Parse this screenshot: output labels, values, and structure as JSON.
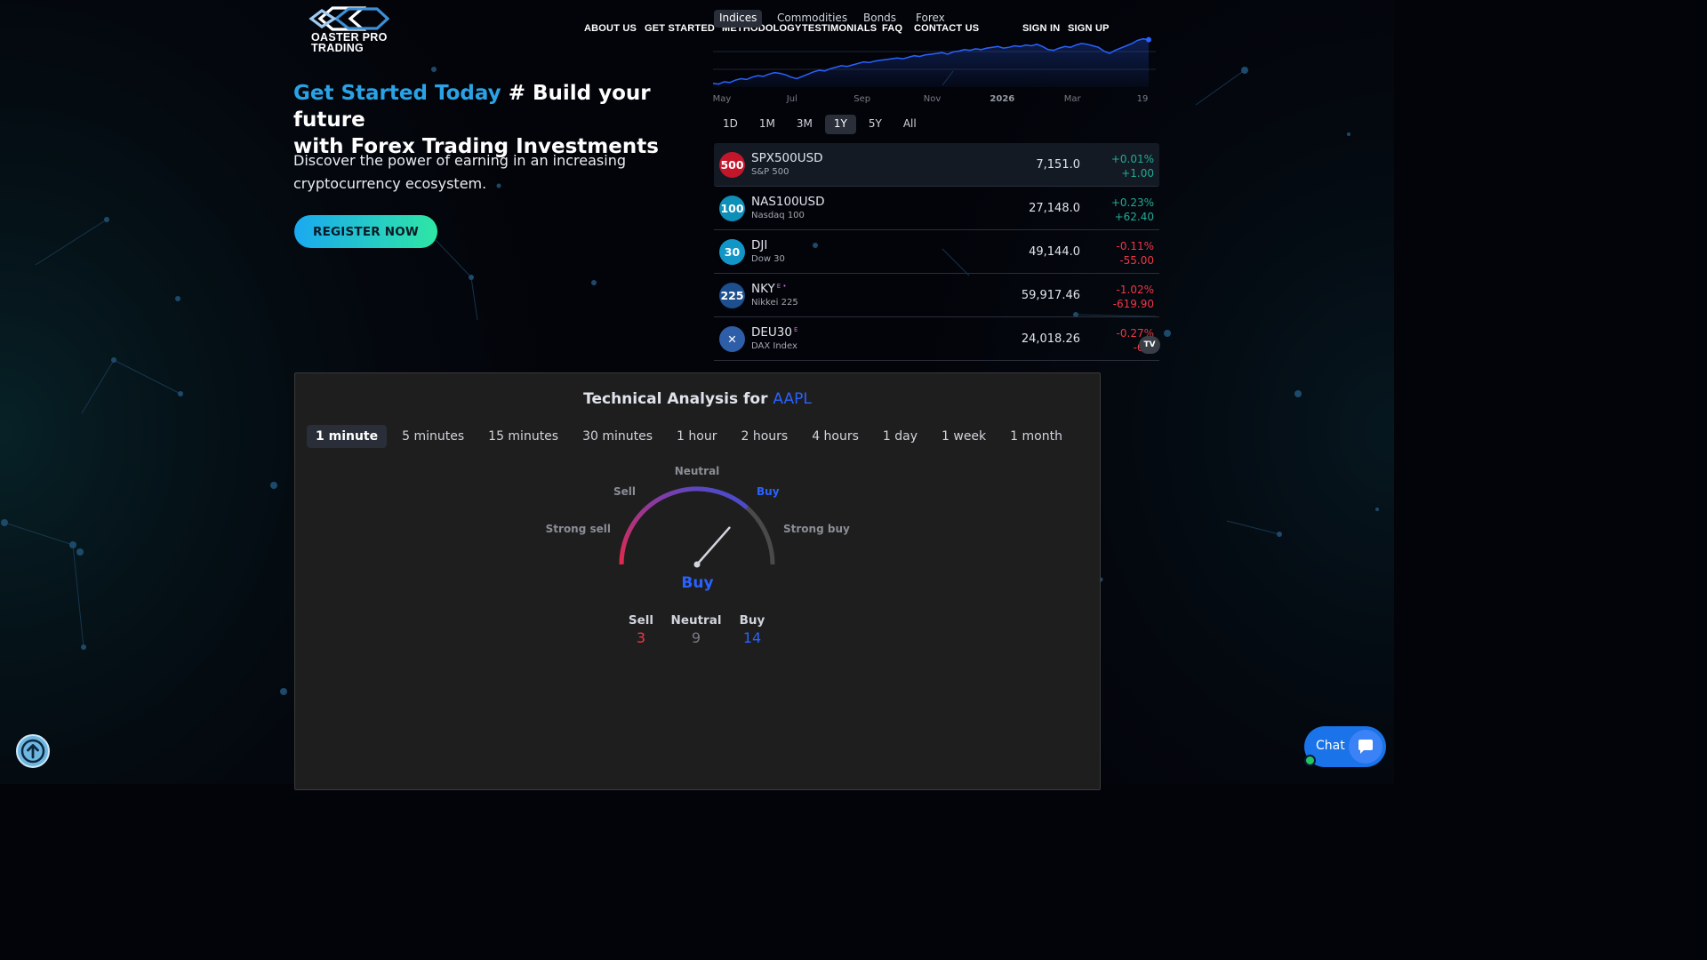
{
  "brand": {
    "line1": "OASTER PRO",
    "line2": "TRADING"
  },
  "nav": {
    "about": "ABOUT US",
    "get_started": "GET STARTED",
    "methodology": "METHODOLOGY",
    "testimonials": "TESTIMONIALS",
    "faq": "FAQ",
    "contact": "CONTACT US",
    "sign_in": "SIGN IN",
    "sign_up": "SIGN UP"
  },
  "market_tabs": [
    "Indices",
    "Commodities",
    "Bonds",
    "Forex"
  ],
  "market_tab_active": "Indices",
  "hero": {
    "title_accent": "Get Started Today",
    "title_rest_1": " # Build your future",
    "title_rest_2": "with Forex Trading Investments",
    "subtitle_1": "Discover the power of earning in an increasing",
    "subtitle_2": "cryptocurrency ecosystem.",
    "cta": "REGISTER NOW"
  },
  "chart_data": {
    "type": "area",
    "series": [
      {
        "values": [
          100,
          99,
          102,
          101,
          104,
          106,
          105,
          108,
          110,
          109,
          112,
          114,
          113,
          111,
          108,
          106,
          109,
          112,
          115,
          117,
          116,
          119,
          121,
          123,
          122,
          124,
          126,
          128,
          127,
          129,
          130,
          131,
          132,
          133,
          132,
          134,
          136,
          135,
          137,
          138,
          139,
          140,
          138,
          141,
          142,
          144,
          143,
          145,
          144,
          146,
          147,
          148,
          146,
          147,
          149,
          148,
          150,
          149,
          151,
          148,
          144,
          143,
          146,
          148,
          147,
          150,
          152,
          151,
          149,
          147,
          142,
          139,
          143,
          146,
          149,
          152,
          156,
          158,
          157
        ]
      }
    ],
    "x_tick_labels": [
      "May",
      "Jul",
      "Sep",
      "Nov",
      "2026",
      "Mar",
      "19"
    ],
    "line_color": "#2962ff"
  },
  "ranges": [
    "1D",
    "1M",
    "3M",
    "1Y",
    "5Y",
    "All"
  ],
  "range_active": "1Y",
  "symbols": [
    {
      "badge": "500",
      "badge_color": "#c4162a",
      "symbol": "SPX500USD",
      "sup": "",
      "desc": "S&P 500",
      "price": "7,151.0",
      "pct": "+0.01%",
      "chg": "+1.00",
      "dir": "up"
    },
    {
      "badge": "100",
      "badge_color": "#0e8fb8",
      "symbol": "NAS100USD",
      "sup": "",
      "desc": "Nasdaq 100",
      "price": "27,148.0",
      "pct": "+0.23%",
      "chg": "+62.40",
      "dir": "up"
    },
    {
      "badge": "30",
      "badge_color": "#1296c7",
      "symbol": "DJI",
      "sup": "",
      "desc": "Dow 30",
      "price": "49,144.0",
      "pct": "-0.11%",
      "chg": "-55.00",
      "dir": "down"
    },
    {
      "badge": "225",
      "badge_color": "#1d4f8f",
      "symbol": "NKY",
      "sup": "E •",
      "desc": "Nikkei 225",
      "price": "59,917.46",
      "pct": "-1.02%",
      "chg": "-619.90",
      "dir": "down"
    },
    {
      "badge": "✕",
      "badge_color": "#2e5ea8",
      "symbol": "DEU30",
      "sup": "E",
      "desc": "DAX Index",
      "price": "24,018.26",
      "pct": "-0.27%",
      "chg": "-65.",
      "dir": "down"
    }
  ],
  "tv_logo": "TV",
  "ta": {
    "title": "Technical Analysis for",
    "ticker": "AAPL",
    "intervals": [
      "1 minute",
      "5 minutes",
      "15 minutes",
      "30 minutes",
      "1 hour",
      "2 hours",
      "4 hours",
      "1 day",
      "1 week",
      "1 month"
    ],
    "interval_active": "1 minute",
    "gauge_labels": {
      "strong_sell": "Strong sell",
      "sell": "Sell",
      "neutral": "Neutral",
      "buy": "Buy",
      "strong_buy": "Strong buy"
    },
    "gauge_value": 0.73,
    "verdict": "Buy",
    "counts": [
      {
        "label": "Sell",
        "value": "3",
        "color": "#f23645"
      },
      {
        "label": "Neutral",
        "value": "9",
        "color": "#787b86"
      },
      {
        "label": "Buy",
        "value": "14",
        "color": "#2962ff"
      }
    ]
  },
  "chat_label": "Chat",
  "colors": {
    "accent": "#2aa3e6",
    "buy": "#2962ff",
    "sell": "#f23645",
    "up": "#22ab94"
  }
}
